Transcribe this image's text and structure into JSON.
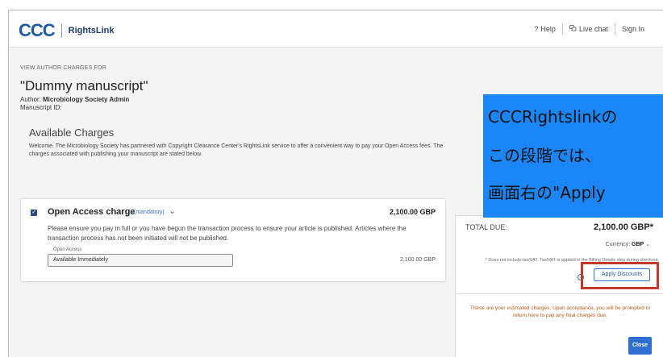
{
  "header": {
    "logo_mark": "CCC",
    "logo_product": "RightsLink",
    "nav": [
      {
        "icon": "question-mark",
        "label": "Help"
      },
      {
        "icon": "chat-bubbles",
        "label": "Live chat"
      },
      {
        "icon": "",
        "label": "Sign In"
      }
    ]
  },
  "main": {
    "view_label": "VIEW AUTHOR CHARGES FOR",
    "manuscript_title": "\"Dummy manuscript\"",
    "author_prefix": "Author: ",
    "author_name": "Microbiology Society Admin",
    "manuscript_id_label": "Manuscript ID:",
    "section_title": "Available Charges",
    "welcome_text": "Welcome. The Microbiology Society has partnered with Copyright Clearance Center's RightsLink service to offer a convenient way to pay your Open Access fees. The charges associated with publishing your manuscript are stated below."
  },
  "charge": {
    "checked": true,
    "name": "Open Access charge",
    "mandatory_label": "(mandatory)",
    "amount": "2,100.00 GBP",
    "description": "Please ensure you pay in full or you have begun the transaction process to ensure your article is published. Articles where the transaction process has not been initiated will not be published.",
    "option_label": "Open Access",
    "option_value": "Available Immediately",
    "option_amount": "2,100.00 GBP"
  },
  "summary": {
    "total_label": "TOTAL DUE:",
    "total_value": "2,100.00 GBP*",
    "currency_label": "Currency:",
    "currency_value": "GBP",
    "tax_note": "* Does not include tax/VAT. Tax/VAT is applied in the Billing Details step during checkout.",
    "apply_discounts_label": "Apply Discounts",
    "estimate_note": "These are your estimated charges. Upon acceptance, you will be prompted to return here to pay any final charges due.",
    "close_label": "Close"
  },
  "overlay": {
    "lines": [
      "CCCRightslinkの",
      "この段階では、",
      "画面右の\"Apply"
    ]
  },
  "colors": {
    "brand_blue": "#1f5aa6",
    "accent_blue": "#2f6fd1",
    "overlay_blue": "#1b86f7",
    "highlight_red": "#c0392b",
    "note_orange": "#c05a1a"
  }
}
